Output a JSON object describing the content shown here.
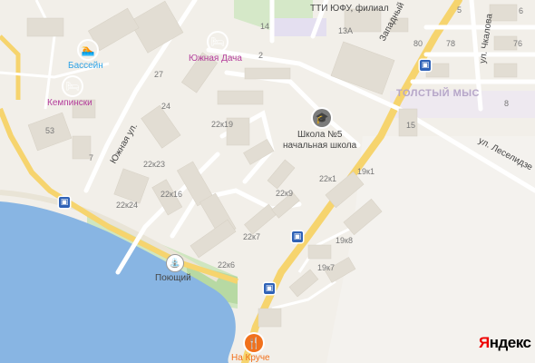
{
  "colors": {
    "water": "#88b5e3",
    "park": "#cfe6c0",
    "road_major": "#f6d46e",
    "building": "#e2ddd3",
    "hotel_pin": "#b43d9c",
    "pool_pin": "#2fa3e6",
    "school_pin": "#7b7b7b",
    "cafe_pin": "#f1711c"
  },
  "pois": {
    "pool": {
      "label": "Бассейн",
      "icon": "swimmer-icon"
    },
    "hotel": {
      "label": "Кемпински",
      "icon": "bed-icon"
    },
    "yuzhnaya_dacha": {
      "label": "Южная Дача",
      "icon": "bed-icon"
    },
    "school": {
      "label": "Школа №5",
      "sublabel": "начальная школа",
      "icon": "school-icon"
    },
    "tti": {
      "label": "ТТИ ЮФУ, филиал"
    },
    "fountain": {
      "label": "Поющий",
      "icon": "fountain-icon"
    },
    "na_kruche": {
      "label": "На Круче",
      "icon": "fork-knife-icon"
    }
  },
  "streets": {
    "yuzhnaya": "Южная ул.",
    "zapadny": "Западный",
    "chkalova": "ул. Чкалова",
    "leselidze": "ул. Леселидзе"
  },
  "district": "ТОЛСТЫЙ МЫС",
  "house_numbers": [
    "14",
    "13А",
    "2",
    "27",
    "24",
    "53",
    "7",
    "22к19",
    "22к23",
    "22к24",
    "22к16",
    "22к1",
    "22к9",
    "19к1",
    "22к7",
    "19к8",
    "22к6",
    "19к7",
    "15",
    "5",
    "6",
    "80",
    "78",
    "76",
    "8"
  ],
  "logo": {
    "first": "Я",
    "rest": "ндекс"
  }
}
